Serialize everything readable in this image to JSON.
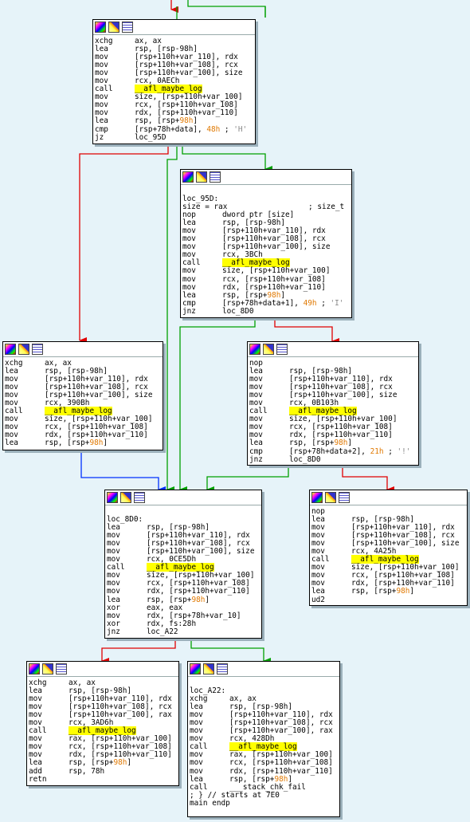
{
  "blocks": [
    {
      "id": "b1",
      "lines": [
        {
          "m": "xchg",
          "ops": [
            {
              "t": "ax, ax"
            }
          ]
        },
        {
          "m": "lea",
          "ops": [
            {
              "t": "rsp, [rsp-98h]"
            }
          ]
        },
        {
          "m": "mov",
          "ops": [
            {
              "t": "[rsp+110h+var_110], rdx"
            }
          ]
        },
        {
          "m": "mov",
          "ops": [
            {
              "t": "[rsp+110h+var_108], rcx"
            }
          ]
        },
        {
          "m": "mov",
          "ops": [
            {
              "t": "[rsp+110h+var_100], size"
            }
          ]
        },
        {
          "m": "mov",
          "ops": [
            {
              "t": "rcx, 0AECh"
            }
          ]
        },
        {
          "m": "call",
          "ops": [
            {
              "t": "__afl_maybe_log",
              "c": "y"
            }
          ]
        },
        {
          "m": "mov",
          "ops": [
            {
              "t": "size, [rsp+110h+var_100]"
            }
          ]
        },
        {
          "m": "mov",
          "ops": [
            {
              "t": "rcx, [rsp+110h+var_108]"
            }
          ]
        },
        {
          "m": "mov",
          "ops": [
            {
              "t": "rdx, [rsp+110h+var_110]"
            }
          ]
        },
        {
          "m": "lea",
          "ops": [
            {
              "t": "rsp, [rsp+"
            },
            {
              "t": "98h",
              "c": "o"
            },
            {
              "t": "]"
            }
          ]
        },
        {
          "m": "cmp",
          "ops": [
            {
              "t": "[rsp+78h+data], "
            },
            {
              "t": "48h",
              "c": "o"
            },
            {
              "t": " ; "
            },
            {
              "t": "'H'",
              "c": "g"
            }
          ]
        },
        {
          "m": "jz",
          "ops": [
            {
              "t": "loc_95D"
            }
          ]
        }
      ]
    },
    {
      "id": "b2",
      "lines": [
        {
          "raw": ""
        },
        {
          "raw": "loc_95D:"
        },
        {
          "raw": "size = rax                  ; size_t"
        },
        {
          "m": "nop",
          "ops": [
            {
              "t": "dword ptr [size]"
            }
          ]
        },
        {
          "m": "lea",
          "ops": [
            {
              "t": "rsp, [rsp-98h]"
            }
          ]
        },
        {
          "m": "mov",
          "ops": [
            {
              "t": "[rsp+110h+var_110], rdx"
            }
          ]
        },
        {
          "m": "mov",
          "ops": [
            {
              "t": "[rsp+110h+var_108], rcx"
            }
          ]
        },
        {
          "m": "mov",
          "ops": [
            {
              "t": "[rsp+110h+var_100], size"
            }
          ]
        },
        {
          "m": "mov",
          "ops": [
            {
              "t": "rcx, 3BCh"
            }
          ]
        },
        {
          "m": "call",
          "ops": [
            {
              "t": "__afl_maybe_log",
              "c": "y"
            }
          ]
        },
        {
          "m": "mov",
          "ops": [
            {
              "t": "size, [rsp+110h+var_100]"
            }
          ]
        },
        {
          "m": "mov",
          "ops": [
            {
              "t": "rcx, [rsp+110h+var_108]"
            }
          ]
        },
        {
          "m": "mov",
          "ops": [
            {
              "t": "rdx, [rsp+110h+var_110]"
            }
          ]
        },
        {
          "m": "lea",
          "ops": [
            {
              "t": "rsp, [rsp+"
            },
            {
              "t": "98h",
              "c": "o"
            },
            {
              "t": "]"
            }
          ]
        },
        {
          "m": "cmp",
          "ops": [
            {
              "t": "[rsp+78h+data+1], "
            },
            {
              "t": "49h",
              "c": "o"
            },
            {
              "t": " ; "
            },
            {
              "t": "'I'",
              "c": "g"
            }
          ]
        },
        {
          "m": "jnz",
          "ops": [
            {
              "t": "loc_8D0"
            }
          ]
        }
      ]
    },
    {
      "id": "b3",
      "lines": [
        {
          "m": "xchg",
          "ops": [
            {
              "t": "ax, ax"
            }
          ]
        },
        {
          "m": "lea",
          "ops": [
            {
              "t": "rsp, [rsp-98h]"
            }
          ]
        },
        {
          "m": "mov",
          "ops": [
            {
              "t": "[rsp+110h+var_110], rdx"
            }
          ]
        },
        {
          "m": "mov",
          "ops": [
            {
              "t": "[rsp+110h+var_108], rcx"
            }
          ]
        },
        {
          "m": "mov",
          "ops": [
            {
              "t": "[rsp+110h+var_100], size"
            }
          ]
        },
        {
          "m": "mov",
          "ops": [
            {
              "t": "rcx, 390Bh"
            }
          ]
        },
        {
          "m": "call",
          "ops": [
            {
              "t": "__afl_maybe_log",
              "c": "y"
            }
          ]
        },
        {
          "m": "mov",
          "ops": [
            {
              "t": "size, [rsp+110h+var_100]"
            }
          ]
        },
        {
          "m": "mov",
          "ops": [
            {
              "t": "rcx, [rsp+110h+var_108]"
            }
          ]
        },
        {
          "m": "mov",
          "ops": [
            {
              "t": "rdx, [rsp+110h+var_110]"
            }
          ]
        },
        {
          "m": "lea",
          "ops": [
            {
              "t": "rsp, [rsp+"
            },
            {
              "t": "98h",
              "c": "o"
            },
            {
              "t": "]"
            }
          ]
        }
      ]
    },
    {
      "id": "b4",
      "lines": [
        {
          "m": "nop",
          "ops": []
        },
        {
          "m": "lea",
          "ops": [
            {
              "t": "rsp, [rsp-98h]"
            }
          ]
        },
        {
          "m": "mov",
          "ops": [
            {
              "t": "[rsp+110h+var_110], rdx"
            }
          ]
        },
        {
          "m": "mov",
          "ops": [
            {
              "t": "[rsp+110h+var_108], rcx"
            }
          ]
        },
        {
          "m": "mov",
          "ops": [
            {
              "t": "[rsp+110h+var_100], size"
            }
          ]
        },
        {
          "m": "mov",
          "ops": [
            {
              "t": "rcx, 0B103h"
            }
          ]
        },
        {
          "m": "call",
          "ops": [
            {
              "t": "__afl_maybe_log",
              "c": "y"
            }
          ]
        },
        {
          "m": "mov",
          "ops": [
            {
              "t": "size, [rsp+110h+var_100]"
            }
          ]
        },
        {
          "m": "mov",
          "ops": [
            {
              "t": "rcx, [rsp+110h+var_108]"
            }
          ]
        },
        {
          "m": "mov",
          "ops": [
            {
              "t": "rdx, [rsp+110h+var_110]"
            }
          ]
        },
        {
          "m": "lea",
          "ops": [
            {
              "t": "rsp, [rsp+"
            },
            {
              "t": "98h",
              "c": "o"
            },
            {
              "t": "]"
            }
          ]
        },
        {
          "m": "cmp",
          "ops": [
            {
              "t": "[rsp+78h+data+2], "
            },
            {
              "t": "21h",
              "c": "o"
            },
            {
              "t": " ; "
            },
            {
              "t": "'!'",
              "c": "g"
            }
          ]
        },
        {
          "m": "jnz",
          "ops": [
            {
              "t": "loc_8D0"
            }
          ]
        }
      ]
    },
    {
      "id": "b5",
      "lines": [
        {
          "raw": ""
        },
        {
          "raw": "loc_8D0:"
        },
        {
          "m": "lea",
          "ops": [
            {
              "t": "rsp, [rsp-98h]"
            }
          ]
        },
        {
          "m": "mov",
          "ops": [
            {
              "t": "[rsp+110h+var_110], rdx"
            }
          ]
        },
        {
          "m": "mov",
          "ops": [
            {
              "t": "[rsp+110h+var_108], rcx"
            }
          ]
        },
        {
          "m": "mov",
          "ops": [
            {
              "t": "[rsp+110h+var_100], size"
            }
          ]
        },
        {
          "m": "mov",
          "ops": [
            {
              "t": "rcx, 0CE5Dh"
            }
          ]
        },
        {
          "m": "call",
          "ops": [
            {
              "t": "__afl_maybe_log",
              "c": "y"
            }
          ]
        },
        {
          "m": "mov",
          "ops": [
            {
              "t": "size, [rsp+110h+var_100]"
            }
          ]
        },
        {
          "m": "mov",
          "ops": [
            {
              "t": "rcx, [rsp+110h+var_108]"
            }
          ]
        },
        {
          "m": "mov",
          "ops": [
            {
              "t": "rdx, [rsp+110h+var_110]"
            }
          ]
        },
        {
          "m": "lea",
          "ops": [
            {
              "t": "rsp, [rsp+"
            },
            {
              "t": "98h",
              "c": "o"
            },
            {
              "t": "]"
            }
          ]
        },
        {
          "m": "xor",
          "ops": [
            {
              "t": "eax, eax"
            }
          ]
        },
        {
          "m": "mov",
          "ops": [
            {
              "t": "rdx, [rsp+78h+var_10]"
            }
          ]
        },
        {
          "m": "xor",
          "ops": [
            {
              "t": "rdx, fs:28h"
            }
          ]
        },
        {
          "m": "jnz",
          "ops": [
            {
              "t": "loc_A22"
            }
          ]
        }
      ]
    },
    {
      "id": "b6",
      "lines": [
        {
          "m": "nop",
          "ops": []
        },
        {
          "m": "lea",
          "ops": [
            {
              "t": "rsp, [rsp-98h]"
            }
          ]
        },
        {
          "m": "mov",
          "ops": [
            {
              "t": "[rsp+110h+var_110], rdx"
            }
          ]
        },
        {
          "m": "mov",
          "ops": [
            {
              "t": "[rsp+110h+var_108], rcx"
            }
          ]
        },
        {
          "m": "mov",
          "ops": [
            {
              "t": "[rsp+110h+var_100], size"
            }
          ]
        },
        {
          "m": "mov",
          "ops": [
            {
              "t": "rcx, 4A25h"
            }
          ]
        },
        {
          "m": "call",
          "ops": [
            {
              "t": "__afl_maybe_log",
              "c": "y"
            }
          ]
        },
        {
          "m": "mov",
          "ops": [
            {
              "t": "size, [rsp+110h+var_100]"
            }
          ]
        },
        {
          "m": "mov",
          "ops": [
            {
              "t": "rcx, [rsp+110h+var_108]"
            }
          ]
        },
        {
          "m": "mov",
          "ops": [
            {
              "t": "rdx, [rsp+110h+var_110]"
            }
          ]
        },
        {
          "m": "lea",
          "ops": [
            {
              "t": "rsp, [rsp+"
            },
            {
              "t": "98h",
              "c": "o"
            },
            {
              "t": "]"
            }
          ]
        },
        {
          "m": "ud2",
          "ops": []
        }
      ]
    },
    {
      "id": "b7",
      "lines": [
        {
          "m": "xchg",
          "ops": [
            {
              "t": "ax, ax"
            }
          ]
        },
        {
          "m": "lea",
          "ops": [
            {
              "t": "rsp, [rsp-98h]"
            }
          ]
        },
        {
          "m": "mov",
          "ops": [
            {
              "t": "[rsp+110h+var_110], rdx"
            }
          ]
        },
        {
          "m": "mov",
          "ops": [
            {
              "t": "[rsp+110h+var_108], rcx"
            }
          ]
        },
        {
          "m": "mov",
          "ops": [
            {
              "t": "[rsp+110h+var_100], rax"
            }
          ]
        },
        {
          "m": "mov",
          "ops": [
            {
              "t": "rcx, 3AD6h"
            }
          ]
        },
        {
          "m": "call",
          "ops": [
            {
              "t": "__afl_maybe_log",
              "c": "y"
            }
          ]
        },
        {
          "m": "mov",
          "ops": [
            {
              "t": "rax, [rsp+110h+var_100]"
            }
          ]
        },
        {
          "m": "mov",
          "ops": [
            {
              "t": "rcx, [rsp+110h+var_108]"
            }
          ]
        },
        {
          "m": "mov",
          "ops": [
            {
              "t": "rdx, [rsp+110h+var_110]"
            }
          ]
        },
        {
          "m": "lea",
          "ops": [
            {
              "t": "rsp, [rsp+"
            },
            {
              "t": "98h",
              "c": "o"
            },
            {
              "t": "]"
            }
          ]
        },
        {
          "m": "add",
          "ops": [
            {
              "t": "rsp, 78h"
            }
          ]
        },
        {
          "m": "retn",
          "ops": []
        }
      ]
    },
    {
      "id": "b8",
      "lines": [
        {
          "raw": ""
        },
        {
          "raw": "loc_A22:"
        },
        {
          "m": "xchg",
          "ops": [
            {
              "t": "ax, ax"
            }
          ]
        },
        {
          "m": "lea",
          "ops": [
            {
              "t": "rsp, [rsp-98h]"
            }
          ]
        },
        {
          "m": "mov",
          "ops": [
            {
              "t": "[rsp+110h+var_110], rdx"
            }
          ]
        },
        {
          "m": "mov",
          "ops": [
            {
              "t": "[rsp+110h+var_108], rcx"
            }
          ]
        },
        {
          "m": "mov",
          "ops": [
            {
              "t": "[rsp+110h+var_100], rax"
            }
          ]
        },
        {
          "m": "mov",
          "ops": [
            {
              "t": "rcx, 428Dh"
            }
          ]
        },
        {
          "m": "call",
          "ops": [
            {
              "t": "__afl_maybe_log",
              "c": "y"
            }
          ]
        },
        {
          "m": "mov",
          "ops": [
            {
              "t": "rax, [rsp+110h+var_100]"
            }
          ]
        },
        {
          "m": "mov",
          "ops": [
            {
              "t": "rcx, [rsp+110h+var_108]"
            }
          ]
        },
        {
          "m": "mov",
          "ops": [
            {
              "t": "rdx, [rsp+110h+var_110]"
            }
          ]
        },
        {
          "m": "lea",
          "ops": [
            {
              "t": "rsp, [rsp+"
            },
            {
              "t": "98h",
              "c": "o"
            },
            {
              "t": "]"
            }
          ]
        },
        {
          "m": "call",
          "ops": [
            {
              "t": "___stack_chk_fail"
            }
          ]
        },
        {
          "raw": "; } // starts at 7E0"
        },
        {
          "raw": "main endp"
        }
      ]
    }
  ],
  "colors": {
    "true_edge": "#00a000",
    "false_edge": "#e00000",
    "uncond_edge": "#0030ff",
    "highlight": "#ffff00",
    "number": "#e07800"
  }
}
